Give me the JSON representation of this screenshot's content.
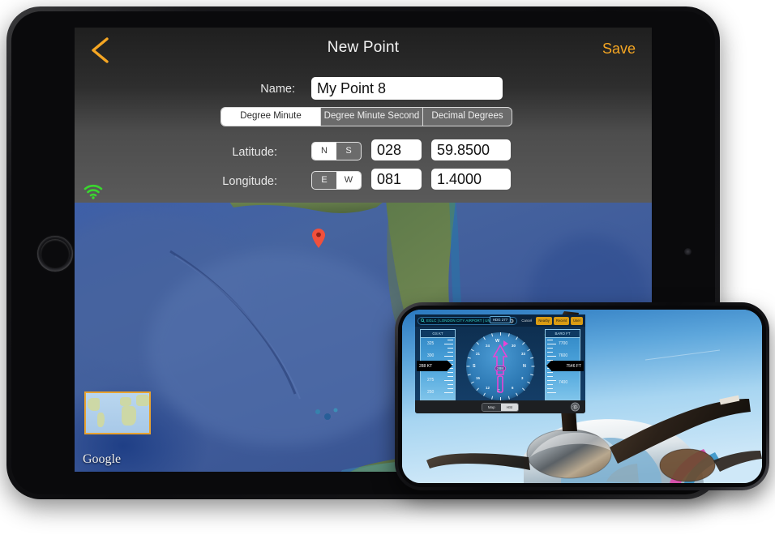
{
  "tablet_app": {
    "nav": {
      "back_icon": "chevron-left-icon",
      "title": "New Point",
      "save_label": "Save"
    },
    "name_field": {
      "label": "Name:",
      "value": "My Point 8"
    },
    "format_segments": [
      {
        "label": "Degree Minute",
        "selected": true
      },
      {
        "label": "Degree Minute Second",
        "selected": false
      },
      {
        "label": "Decimal Degrees",
        "selected": false
      }
    ],
    "latitude": {
      "label": "Latitude:",
      "hemisphere": [
        {
          "label": "N",
          "selected": true
        },
        {
          "label": "S",
          "selected": false
        }
      ],
      "degrees": "028",
      "minutes": "59.8500"
    },
    "longitude": {
      "label": "Longitude:",
      "hemisphere": [
        {
          "label": "E",
          "selected": false
        },
        {
          "label": "W",
          "selected": true
        }
      ],
      "degrees": "081",
      "minutes": "1.4000"
    },
    "status": {
      "wifi_icon": "wifi-icon",
      "wifi_color": "#3ad62f"
    },
    "map": {
      "attribution": "Google",
      "pin_icon": "map-pin-icon",
      "pin_color": "#f0503c",
      "minimap_border_color": "#e9a330"
    }
  },
  "phone_app": {
    "toolbar": {
      "search_icon": "search-icon",
      "search_value": "EGLC | LONDON CITY AIRPORT | UNIT...",
      "clear_icon": "clear-circle-icon",
      "buttons": [
        {
          "label": "Cancel",
          "highlight": false
        },
        {
          "label": "Nearby",
          "highlight": true
        },
        {
          "label": "Recent",
          "highlight": true
        },
        {
          "label": "User",
          "highlight": true
        }
      ]
    },
    "airspeed_tape": {
      "header": "GS KT",
      "readout": "288 KT",
      "ticks": [
        "325",
        "300",
        "275",
        "250"
      ]
    },
    "altitude_tape": {
      "header": "BARO FT",
      "readout": "7546 FT",
      "ticks": [
        "7700",
        "7600",
        "7400"
      ]
    },
    "hsi": {
      "course_label": "HDG 277",
      "bearing_value": "288",
      "cardinals": [
        "N",
        "E",
        "S",
        "W"
      ],
      "minor_labels": [
        "3",
        "6",
        "12",
        "15",
        "21",
        "24",
        "30",
        "33"
      ],
      "needle_color": "#e845d6"
    },
    "footer": {
      "segments": [
        {
          "label": "Map",
          "selected": false
        },
        {
          "label": "HSI",
          "selected": true
        }
      ],
      "settings_icon": "gear-icon"
    },
    "satellite_icon": "satellite-icon"
  },
  "colors": {
    "accent_orange": "#f5a623",
    "nav_dark": "#1f1f1f",
    "nav_light": "#5a5a5a",
    "field_white": "#ffffff"
  }
}
